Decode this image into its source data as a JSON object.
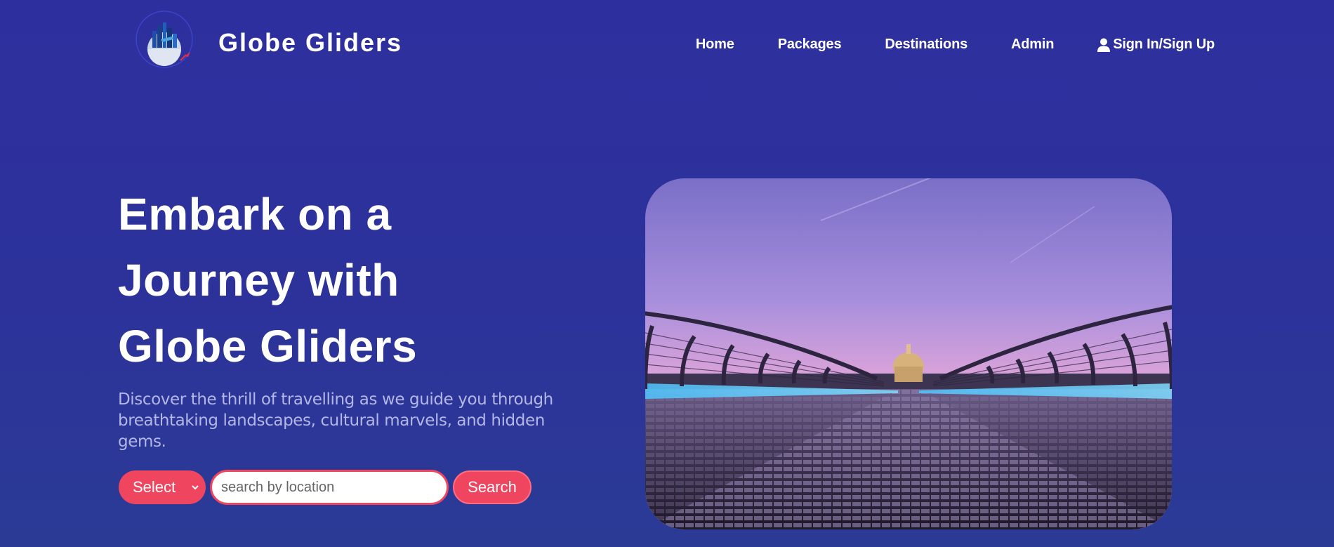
{
  "brand": {
    "name": "Globe Gliders"
  },
  "nav": {
    "home": "Home",
    "packages": "Packages",
    "destinations": "Destinations",
    "admin": "Admin",
    "signin": "Sign In/Sign Up"
  },
  "hero": {
    "title_line1": "Embark on a",
    "title_line2": "Journey with",
    "title_line3": "Globe Gliders",
    "description": "Discover the thrill of travelling as we guide you through breathtaking landscapes, cultural marvels, and hidden gems."
  },
  "search": {
    "select_value": "Select",
    "placeholder": "search by location",
    "button_label": "Search"
  },
  "colors": {
    "background": "#2e2f9f",
    "accent": "#f0455e",
    "description_text": "#b4b6e4"
  },
  "icons": {
    "logo": "globe-city-logo-icon",
    "user": "user-icon",
    "select_chevron": "chevron-down-icon"
  }
}
